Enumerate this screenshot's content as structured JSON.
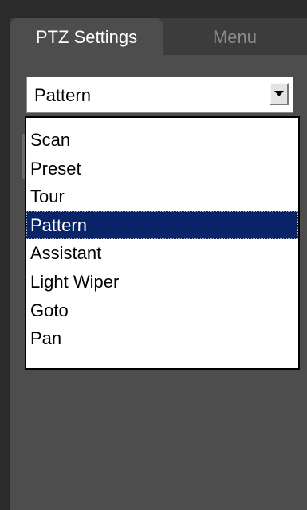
{
  "tabs": [
    {
      "label": "PTZ Settings",
      "active": true
    },
    {
      "label": "Menu",
      "active": false
    }
  ],
  "function_select": {
    "value": "Pattern",
    "button_icon": "chevron-down-icon",
    "options": [
      "Scan",
      "Preset",
      "Tour",
      "Pattern",
      "Assistant",
      "Light Wiper",
      "Goto",
      "Pan"
    ],
    "selected_index": 3
  },
  "colors": {
    "highlight": "#0a246a",
    "panel": "#4d4d4d",
    "tabbar": "#3c3c3c"
  }
}
